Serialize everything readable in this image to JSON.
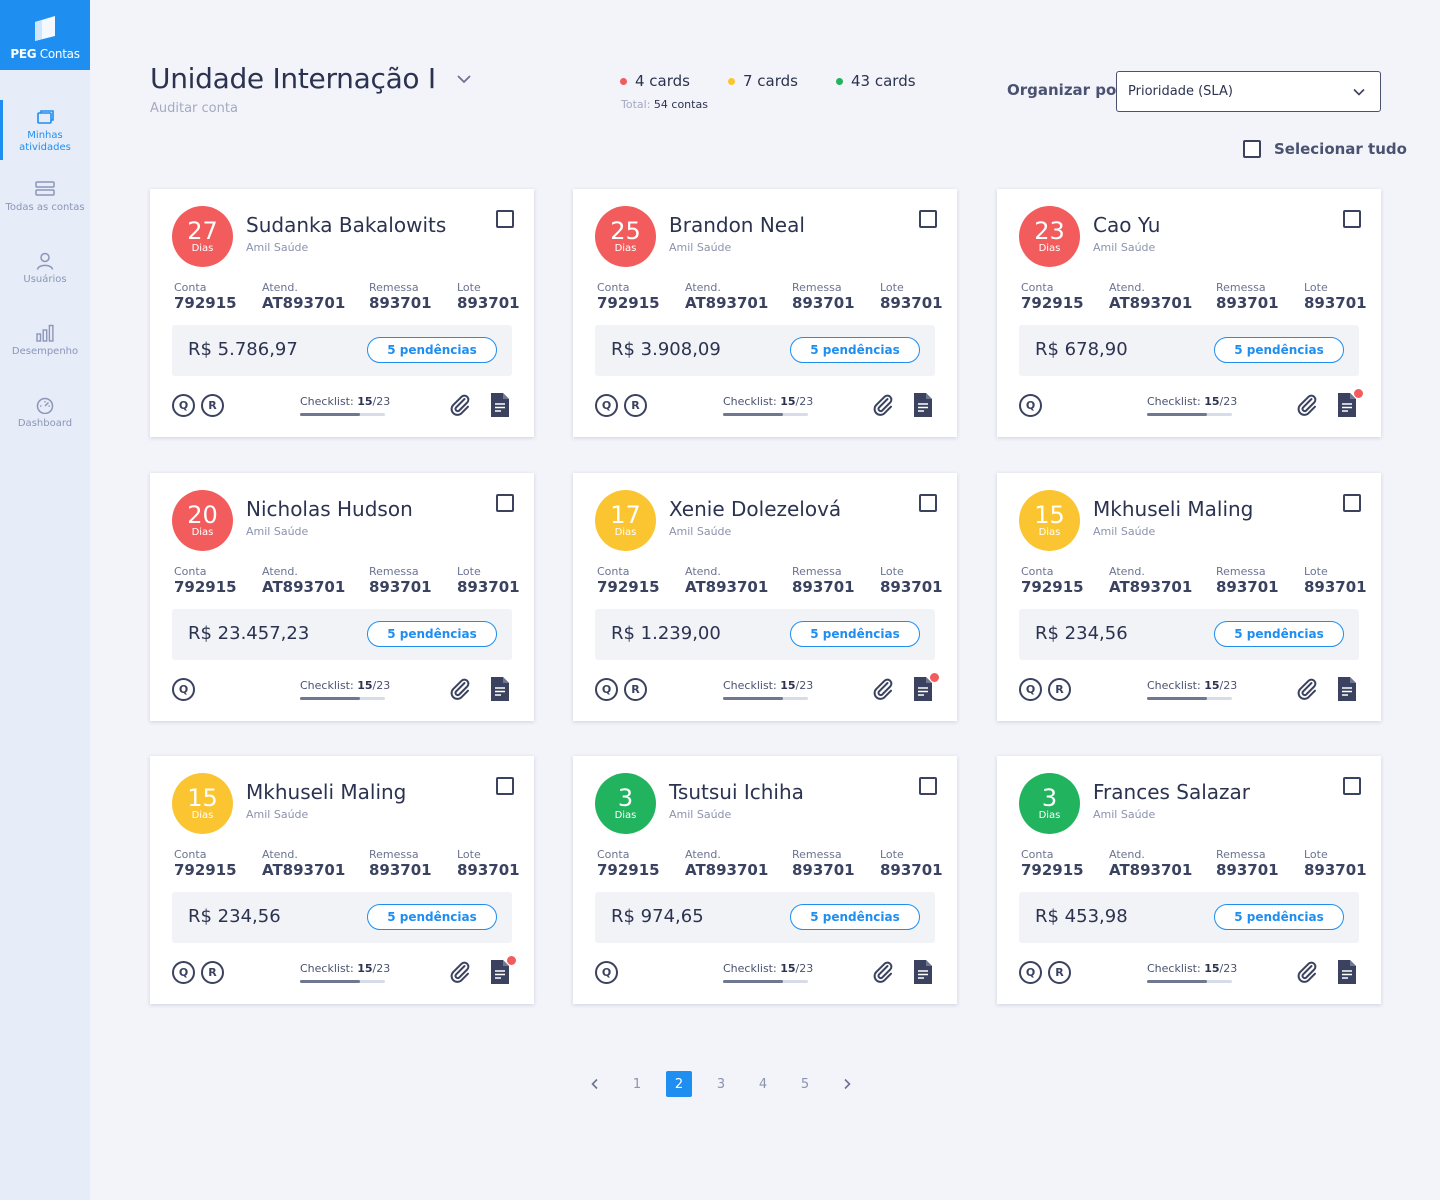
{
  "app": {
    "logo_bold": "PEG",
    "logo_rest": " Contas"
  },
  "sidebar": {
    "items": [
      {
        "label": "Minhas atividades",
        "icon": "activities-icon",
        "active": true
      },
      {
        "label": "Todas as contas",
        "icon": "list-icon",
        "active": false
      },
      {
        "label": "Usuários",
        "icon": "user-icon",
        "active": false
      },
      {
        "label": "Desempenho",
        "icon": "bar-chart-icon",
        "active": false
      },
      {
        "label": "Dashboard",
        "icon": "gauge-icon",
        "active": false
      }
    ]
  },
  "header": {
    "title": "Unidade Internação I",
    "subtitle": "Auditar conta",
    "counts": [
      {
        "label": "4 cards",
        "color": "#f25c5c"
      },
      {
        "label": "7 cards",
        "color": "#fbc531"
      },
      {
        "label": "43 cards",
        "color": "#22b35e"
      }
    ],
    "total_label": "Total:",
    "total_value": "54 contas",
    "sort_label": "Organizar por:",
    "sort_value": "Prioridade (SLA)",
    "select_all": "Selecionar tudo"
  },
  "labels": {
    "dias": "Dias",
    "conta": "Conta",
    "atend": "Atend.",
    "remessa": "Remessa",
    "lote": "Lote",
    "checklist": "Checklist:"
  },
  "colors": {
    "red": "#f25c5c",
    "yellow": "#fbc531",
    "green": "#22b35e",
    "accent": "#1f8ef1"
  },
  "cards": [
    {
      "days": "27",
      "status": "red",
      "name": "Sudanka Bakalowits",
      "insurer": "Amil Saúde",
      "conta": "792915",
      "atend": "AT893701",
      "remessa": "893701",
      "lote": "893701",
      "amount": "R$ 5.786,97",
      "pendencias": "5 pendências",
      "q": "Q",
      "r": "R",
      "checklist_done": "15",
      "checklist_total": "/23",
      "progress": 0.7,
      "doc_alert": false
    },
    {
      "days": "25",
      "status": "red",
      "name": "Brandon Neal",
      "insurer": "Amil Saúde",
      "conta": "792915",
      "atend": "AT893701",
      "remessa": "893701",
      "lote": "893701",
      "amount": "R$ 3.908,09",
      "pendencias": "5 pendências",
      "q": "Q",
      "r": "R",
      "checklist_done": "15",
      "checklist_total": "/23",
      "progress": 0.7,
      "doc_alert": false
    },
    {
      "days": "23",
      "status": "red",
      "name": "Cao Yu",
      "insurer": "Amil Saúde",
      "conta": "792915",
      "atend": "AT893701",
      "remessa": "893701",
      "lote": "893701",
      "amount": "R$ 678,90",
      "pendencias": "5 pendências",
      "q": "Q",
      "r": null,
      "checklist_done": "15",
      "checklist_total": "/23",
      "progress": 0.7,
      "doc_alert": true
    },
    {
      "days": "20",
      "status": "red",
      "name": "Nicholas Hudson",
      "insurer": "Amil Saúde",
      "conta": "792915",
      "atend": "AT893701",
      "remessa": "893701",
      "lote": "893701",
      "amount": "R$ 23.457,23",
      "pendencias": "5 pendências",
      "q": "Q",
      "r": null,
      "checklist_done": "15",
      "checklist_total": "/23",
      "progress": 0.7,
      "doc_alert": false
    },
    {
      "days": "17",
      "status": "yellow",
      "name": "Xenie Dolezelová",
      "insurer": "Amil Saúde",
      "conta": "792915",
      "atend": "AT893701",
      "remessa": "893701",
      "lote": "893701",
      "amount": "R$ 1.239,00",
      "pendencias": "5 pendências",
      "q": "Q",
      "r": "R",
      "checklist_done": "15",
      "checklist_total": "/23",
      "progress": 0.7,
      "doc_alert": true
    },
    {
      "days": "15",
      "status": "yellow",
      "name": "Mkhuseli Maling",
      "insurer": "Amil Saúde",
      "conta": "792915",
      "atend": "AT893701",
      "remessa": "893701",
      "lote": "893701",
      "amount": "R$ 234,56",
      "pendencias": "5 pendências",
      "q": "Q",
      "r": "R",
      "checklist_done": "15",
      "checklist_total": "/23",
      "progress": 0.7,
      "doc_alert": false
    },
    {
      "days": "15",
      "status": "yellow",
      "name": "Mkhuseli Maling",
      "insurer": "Amil Saúde",
      "conta": "792915",
      "atend": "AT893701",
      "remessa": "893701",
      "lote": "893701",
      "amount": "R$ 234,56",
      "pendencias": "5 pendências",
      "q": "Q",
      "r": "R",
      "checklist_done": "15",
      "checklist_total": "/23",
      "progress": 0.7,
      "doc_alert": true
    },
    {
      "days": "3",
      "status": "green",
      "name": "Tsutsui Ichiha",
      "insurer": "Amil Saúde",
      "conta": "792915",
      "atend": "AT893701",
      "remessa": "893701",
      "lote": "893701",
      "amount": "R$ 974,65",
      "pendencias": "5 pendências",
      "q": "Q",
      "r": null,
      "checklist_done": "15",
      "checklist_total": "/23",
      "progress": 0.7,
      "doc_alert": false
    },
    {
      "days": "3",
      "status": "green",
      "name": "Frances Salazar",
      "insurer": "Amil Saúde",
      "conta": "792915",
      "atend": "AT893701",
      "remessa": "893701",
      "lote": "893701",
      "amount": "R$ 453,98",
      "pendencias": "5 pendências",
      "q": "Q",
      "r": "R",
      "checklist_done": "15",
      "checklist_total": "/23",
      "progress": 0.7,
      "doc_alert": false
    }
  ],
  "pagination": {
    "pages": [
      "1",
      "2",
      "3",
      "4",
      "5"
    ],
    "current": "2"
  }
}
